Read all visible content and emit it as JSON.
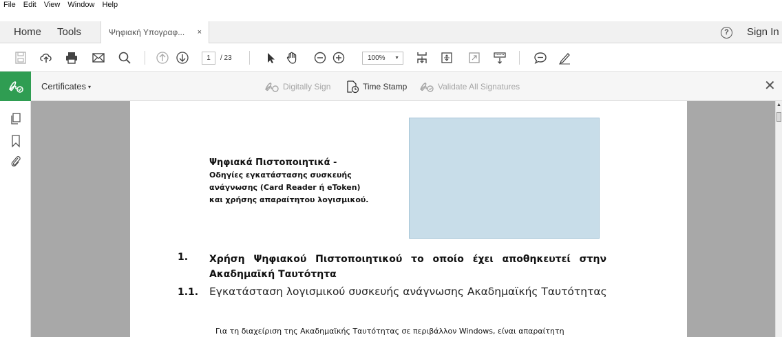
{
  "menu": [
    "File",
    "Edit",
    "View",
    "Window",
    "Help"
  ],
  "tabs": {
    "home": "Home",
    "tools": "Tools",
    "document_tab": "Ψηφιακή Υπογραφ...",
    "close": "×"
  },
  "account": {
    "help": "?",
    "sign_in": "Sign In"
  },
  "toolbar": {
    "current_page": "1",
    "page_total": "/ 23",
    "zoom": "100%",
    "zoom_caret": "▼"
  },
  "certificates_bar": {
    "label": "Certificates",
    "caret": "▾",
    "digitally_sign": "Digitally Sign",
    "time_stamp": "Time Stamp",
    "validate_all": "Validate All Signatures",
    "close": "✕"
  },
  "document": {
    "title": "Ψηφιακά Πιστοποιητικά  -",
    "subtitle_lines": [
      "Οδηγίες εγκατάστασης συσκευής",
      "ανάγνωσης (Card Reader ή eToken)",
      "και χρήσης απαραίτητου λογισμικού."
    ],
    "section1_num": "1.",
    "section1_text": "Χρήση Ψηφιακού Πιστοποιητικού το οποίο έχει αποθηκευτεί στην Ακαδημαϊκή Ταυτότητα",
    "section11_num": "1.1.",
    "section11_text": "Εγκατάσταση λογισμικού συσκευής ανάγνωσης Ακαδημαϊκής Ταυτότητας",
    "body_first_line": "Για τη διαχείριση της Ακαδημαϊκής Ταυτότητας σε περιβάλλον Windows, είναι απαραίτητη"
  },
  "colors": {
    "cert_accent": "#2f9d52",
    "placeholder_box": "#c8dde9",
    "doc_background": "#a8a8a8"
  }
}
